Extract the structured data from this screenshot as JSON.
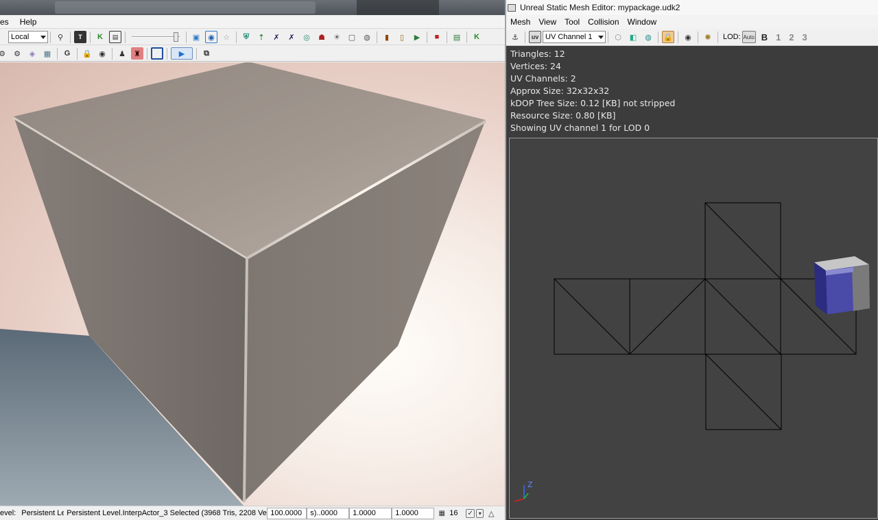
{
  "main_editor": {
    "menu": [
      "es",
      "Help"
    ],
    "toolbar": {
      "coord_system": "Local",
      "gadget_letter": "G"
    },
    "status_bar": {
      "level_label": "evel:",
      "level_value": "Persistent Le",
      "selection": "Persistent Level.InterpActor_3 Selected (3968 Tris, 2208 Vert",
      "field_1": "100.0000",
      "field_2": "s)..0000",
      "field_3": "1.0000",
      "field_4": "1.0000",
      "grid_size": "16"
    }
  },
  "mesh_editor": {
    "title": "Unreal Static Mesh Editor: mypackage.udk2",
    "menu": [
      "Mesh",
      "View",
      "Tool",
      "Collision",
      "Window"
    ],
    "toolbar": {
      "uv_channel": "UV Channel 1",
      "lod_label": "LOD:",
      "lod_auto": "Auto",
      "lod_levels": [
        "B",
        "1",
        "2",
        "3"
      ]
    },
    "stats": {
      "triangles": "Triangles:  12",
      "vertices": "Vertices:  24",
      "uv_channels": "UV Channels:  2",
      "approx_size": "Approx Size: 32x32x32",
      "kdop": "kDOP Tree Size: 0.12 [KB] not stripped",
      "resource_size": "Resource Size: 0.80 [KB]",
      "showing": "Showing UV channel 1 for LOD 0"
    },
    "axis_labels": {
      "z": "Z"
    }
  },
  "colors": {
    "viewport_bg": "#3c3c3c",
    "stats_text": "#e8e8e8",
    "uv_lines": "#000000",
    "preview_cube_face": "#3c3ca0",
    "cube_surface": "#a29890"
  }
}
